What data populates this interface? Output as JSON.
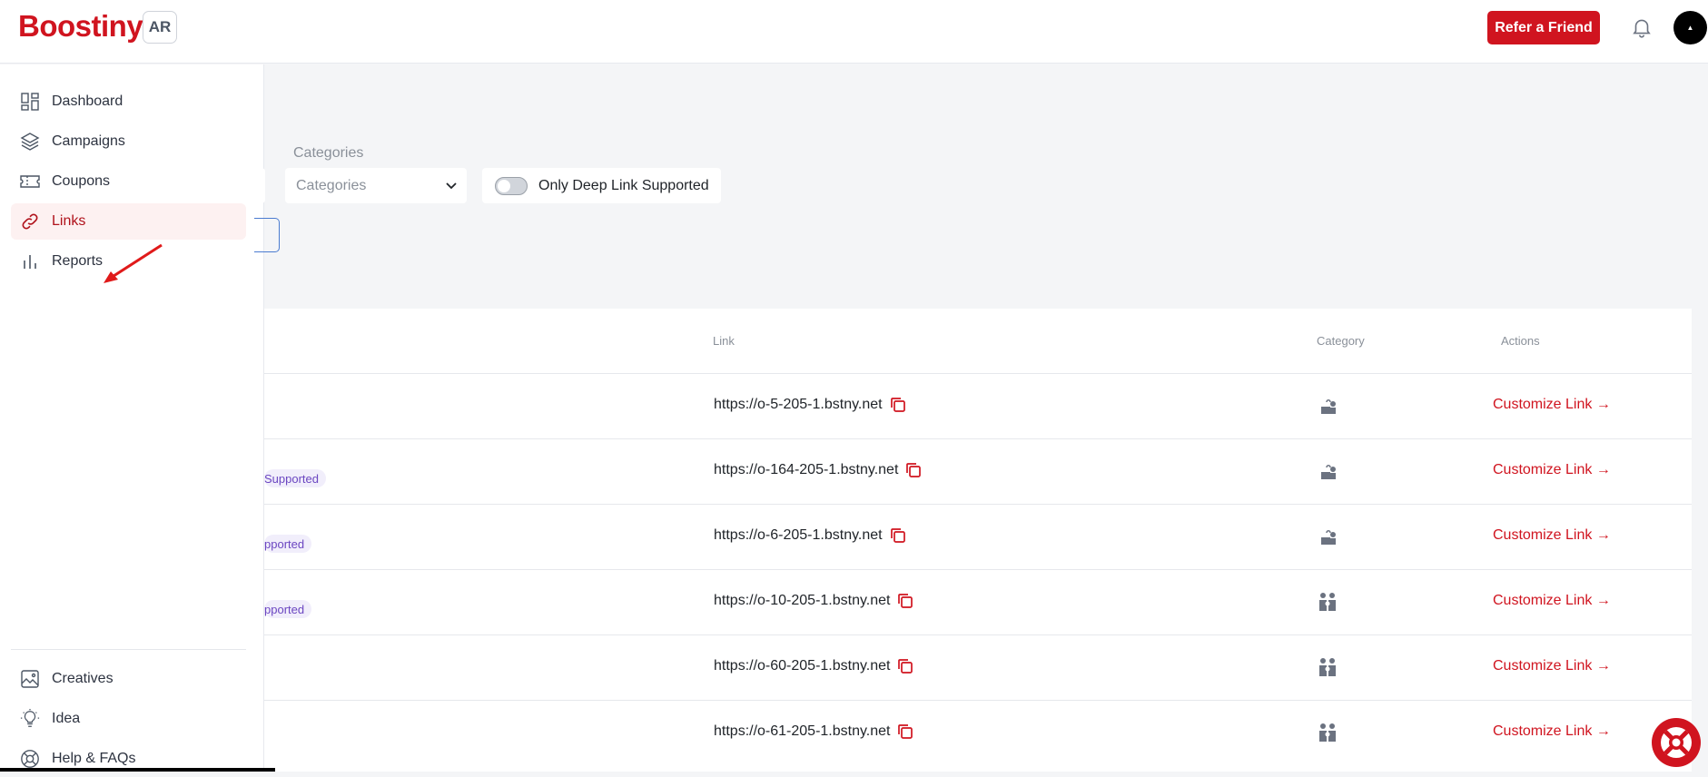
{
  "header": {
    "logo": "Boostiny",
    "language": "AR",
    "refer_label": "Refer a Friend"
  },
  "sidebar": {
    "items": [
      {
        "label": "Dashboard",
        "icon": "dashboard-icon"
      },
      {
        "label": "Campaigns",
        "icon": "layers-icon"
      },
      {
        "label": "Coupons",
        "icon": "ticket-icon"
      },
      {
        "label": "Links",
        "icon": "link-icon",
        "active": true
      },
      {
        "label": "Reports",
        "icon": "bar-chart-icon"
      }
    ],
    "bottom_items": [
      {
        "label": "Creatives",
        "icon": "image-icon"
      },
      {
        "label": "Idea",
        "icon": "lightbulb-icon"
      },
      {
        "label": "Help & FAQs",
        "icon": "lifebuoy-icon"
      }
    ]
  },
  "filters": {
    "categories_label": "Categories",
    "categories_placeholder": "Categories",
    "deep_link_label": "Only Deep Link Supported",
    "deep_link_enabled": false
  },
  "table": {
    "headers": {
      "link": "Link",
      "category": "Category",
      "actions": "Actions"
    },
    "rows": [
      {
        "link": "https://o-5-205-1.bstny.net",
        "badge": "",
        "action": "Customize Link",
        "category_icon": "chef-icon"
      },
      {
        "link": "https://o-164-205-1.bstny.net",
        "badge": "Supported",
        "action": "Customize Link",
        "category_icon": "chef-icon"
      },
      {
        "link": "https://o-6-205-1.bstny.net",
        "badge": "pported",
        "action": "Customize Link",
        "category_icon": "chef-icon"
      },
      {
        "link": "https://o-10-205-1.bstny.net",
        "badge": "pported",
        "action": "Customize Link",
        "category_icon": "family-icon"
      },
      {
        "link": "https://o-60-205-1.bstny.net",
        "badge": "",
        "action": "Customize Link",
        "category_icon": "family-icon"
      },
      {
        "link": "https://o-61-205-1.bstny.net",
        "badge": "",
        "action": "Customize Link",
        "category_icon": "family-icon"
      }
    ]
  },
  "colors": {
    "brand": "#d0141f",
    "badge_text": "#6b46c1"
  }
}
